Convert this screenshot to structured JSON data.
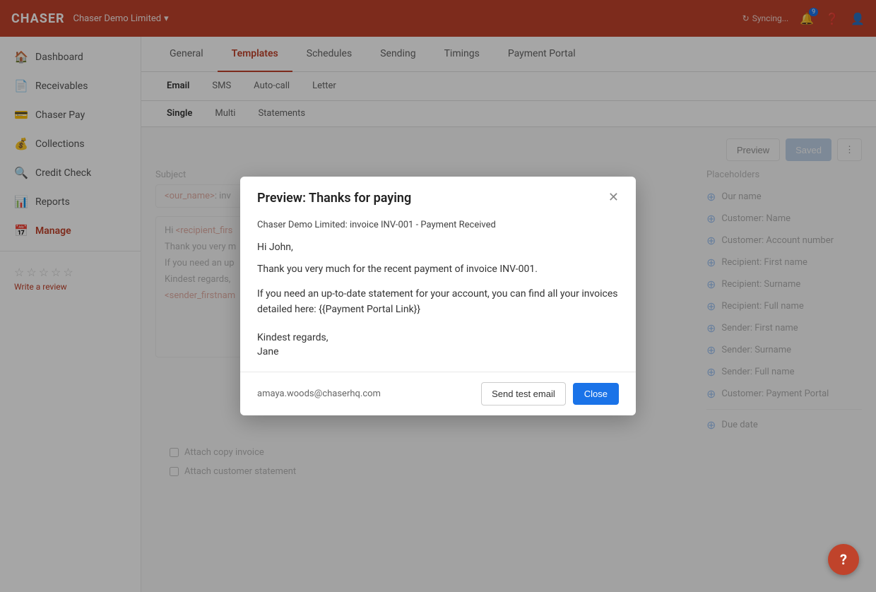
{
  "app": {
    "logo": "CHASER",
    "company": "Chaser Demo Limited",
    "sync_text": "Syncing...",
    "notification_count": "9"
  },
  "sidebar": {
    "items": [
      {
        "id": "dashboard",
        "label": "Dashboard",
        "icon": "🏠"
      },
      {
        "id": "receivables",
        "label": "Receivables",
        "icon": "📄"
      },
      {
        "id": "chaser-pay",
        "label": "Chaser Pay",
        "icon": "💳"
      },
      {
        "id": "collections",
        "label": "Collections",
        "icon": "💰"
      },
      {
        "id": "credit-check",
        "label": "Credit Check",
        "icon": "🔍"
      },
      {
        "id": "reports",
        "label": "Reports",
        "icon": "📊"
      },
      {
        "id": "manage",
        "label": "Manage",
        "icon": "📅"
      }
    ],
    "review": {
      "write_label": "Write a review"
    }
  },
  "main_tabs": [
    {
      "id": "general",
      "label": "General"
    },
    {
      "id": "templates",
      "label": "Templates"
    },
    {
      "id": "schedules",
      "label": "Schedules"
    },
    {
      "id": "sending",
      "label": "Sending"
    },
    {
      "id": "timings",
      "label": "Timings"
    },
    {
      "id": "payment_portal",
      "label": "Payment Portal"
    }
  ],
  "sub_tabs": [
    {
      "id": "email",
      "label": "Email"
    },
    {
      "id": "sms",
      "label": "SMS"
    },
    {
      "id": "auto_call",
      "label": "Auto-call"
    },
    {
      "id": "letter",
      "label": "Letter"
    }
  ],
  "sub_tabs2": [
    {
      "id": "single",
      "label": "Single"
    },
    {
      "id": "multi",
      "label": "Multi"
    },
    {
      "id": "statements",
      "label": "Statements"
    }
  ],
  "editor": {
    "template_title": "Thanks for paying",
    "subject_label": "Subject",
    "subject_value": "<our_name>: inv",
    "body_lines": [
      "Hi <recipient_firs",
      "Thank you very m",
      "If you need an up",
      "Kindest regards,",
      "<sender_firstnam"
    ],
    "toolbar": {
      "preview_label": "Preview",
      "saved_label": "Saved",
      "more_icon": "⋮"
    }
  },
  "placeholders": {
    "title": "Placeholders",
    "items": [
      {
        "label": "Our name"
      },
      {
        "label": "Customer: Name"
      },
      {
        "label": "Customer: Account number"
      },
      {
        "label": "Recipient: First name"
      },
      {
        "label": "Recipient: Surname"
      },
      {
        "label": "Recipient: Full name"
      },
      {
        "label": "Sender: First name"
      },
      {
        "label": "Sender: Surname"
      },
      {
        "label": "Sender: Full name"
      },
      {
        "label": "Customer: Payment Portal"
      },
      {
        "label": "Due date"
      }
    ]
  },
  "modal": {
    "title": "Preview: Thanks for paying",
    "email_subject": "Chaser Demo Limited: invoice INV-001 - Payment Received",
    "greeting": "Hi John,",
    "body1": "Thank you very much for the recent payment of  invoice INV-001.",
    "body2": "If you need an up-to-date statement for your account, you can find all your invoices detailed here:  {{Payment Portal Link}}",
    "closing": "Kindest regards,",
    "signature": "Jane",
    "footer_email": "amaya.woods@chaserhq.com",
    "send_test_label": "Send test email",
    "close_label": "Close"
  },
  "attachments": [
    {
      "label": "Attach copy invoice"
    },
    {
      "label": "Attach customer statement"
    }
  ],
  "help_label": "?"
}
